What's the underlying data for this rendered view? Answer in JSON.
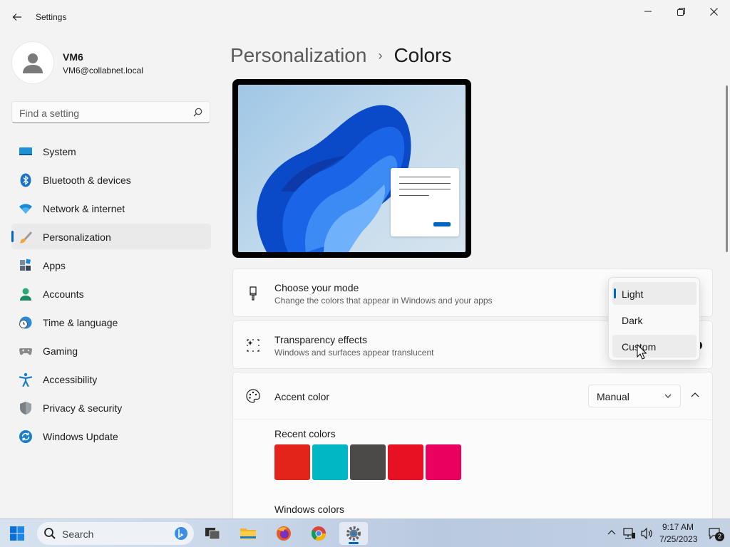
{
  "window": {
    "title": "Settings"
  },
  "profile": {
    "name": "VM6",
    "email": "VM6@collabnet.local"
  },
  "search": {
    "placeholder": "Find a setting"
  },
  "sidebar": {
    "items": [
      {
        "label": "System",
        "icon": "system-icon"
      },
      {
        "label": "Bluetooth & devices",
        "icon": "bluetooth-icon"
      },
      {
        "label": "Network & internet",
        "icon": "wifi-icon"
      },
      {
        "label": "Personalization",
        "icon": "brush-icon",
        "active": true
      },
      {
        "label": "Apps",
        "icon": "apps-icon"
      },
      {
        "label": "Accounts",
        "icon": "accounts-icon"
      },
      {
        "label": "Time & language",
        "icon": "time-icon"
      },
      {
        "label": "Gaming",
        "icon": "gaming-icon"
      },
      {
        "label": "Accessibility",
        "icon": "accessibility-icon"
      },
      {
        "label": "Privacy & security",
        "icon": "shield-icon"
      },
      {
        "label": "Windows Update",
        "icon": "update-icon"
      }
    ]
  },
  "breadcrumb": {
    "parent": "Personalization",
    "separator": "›",
    "current": "Colors"
  },
  "mode_card": {
    "title": "Choose your mode",
    "subtitle": "Change the colors that appear in Windows and your apps"
  },
  "transparency_card": {
    "title": "Transparency effects",
    "subtitle": "Windows and surfaces appear translucent"
  },
  "accent_card": {
    "title": "Accent color",
    "dropdown_value": "Manual"
  },
  "recent_colors": {
    "label": "Recent colors",
    "colors": [
      "#e3241b",
      "#00b7c3",
      "#4c4a48",
      "#e81123",
      "#ea005e"
    ]
  },
  "windows_colors": {
    "label": "Windows colors"
  },
  "mode_popup": {
    "options": [
      "Light",
      "Dark",
      "Custom"
    ],
    "selected": "Light",
    "hovered": "Custom"
  },
  "taskbar": {
    "search_label": "Search",
    "time": "9:17 AM",
    "date": "7/25/2023",
    "notification_count": "2"
  },
  "colors": {
    "accent": "#0067c0"
  }
}
